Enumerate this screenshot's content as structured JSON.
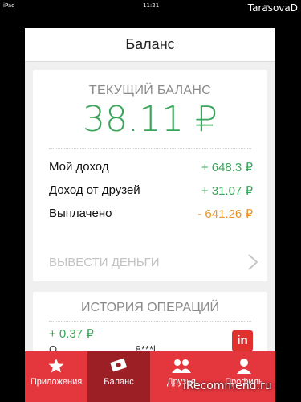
{
  "status": {
    "carrier": "iPad",
    "time": "11:21"
  },
  "watermark_top": "TarasovaD",
  "navbar": {
    "title": "Баланс"
  },
  "balance": {
    "label": "ТЕКУЩИЙ БАЛАНС",
    "amount": "38.11 ₽",
    "rows": [
      {
        "label": "Мой доход",
        "value": "+ 648.3 ₽"
      },
      {
        "label": "Доход от друзей",
        "value": "+ 31.07 ₽"
      },
      {
        "label": "Выплачено",
        "value": "- 641.26 ₽"
      }
    ]
  },
  "withdraw": {
    "label": "ВЫВЕСТИ ДЕНЬГИ"
  },
  "history": {
    "title": "ИСТОРИЯ ОПЕРАЦИЙ",
    "items": [
      {
        "amount": "+ 0.37 ₽",
        "description": "О...........................8***l..."
      }
    ],
    "badge": "in"
  },
  "tabs": [
    {
      "label": "Приложения",
      "icon": "star-icon",
      "active": false
    },
    {
      "label": "Баланс",
      "icon": "money-icon",
      "active": true
    },
    {
      "label": "Друзья",
      "icon": "friends-icon",
      "active": false
    },
    {
      "label": "Профиль",
      "icon": "profile-icon",
      "active": false
    }
  ],
  "watermark_bottom": "iRecommend.ru",
  "colors": {
    "accent": "#e3363d",
    "accent_active": "#9b1f24",
    "positive": "#3aa55a",
    "negative": "#e8952e"
  }
}
